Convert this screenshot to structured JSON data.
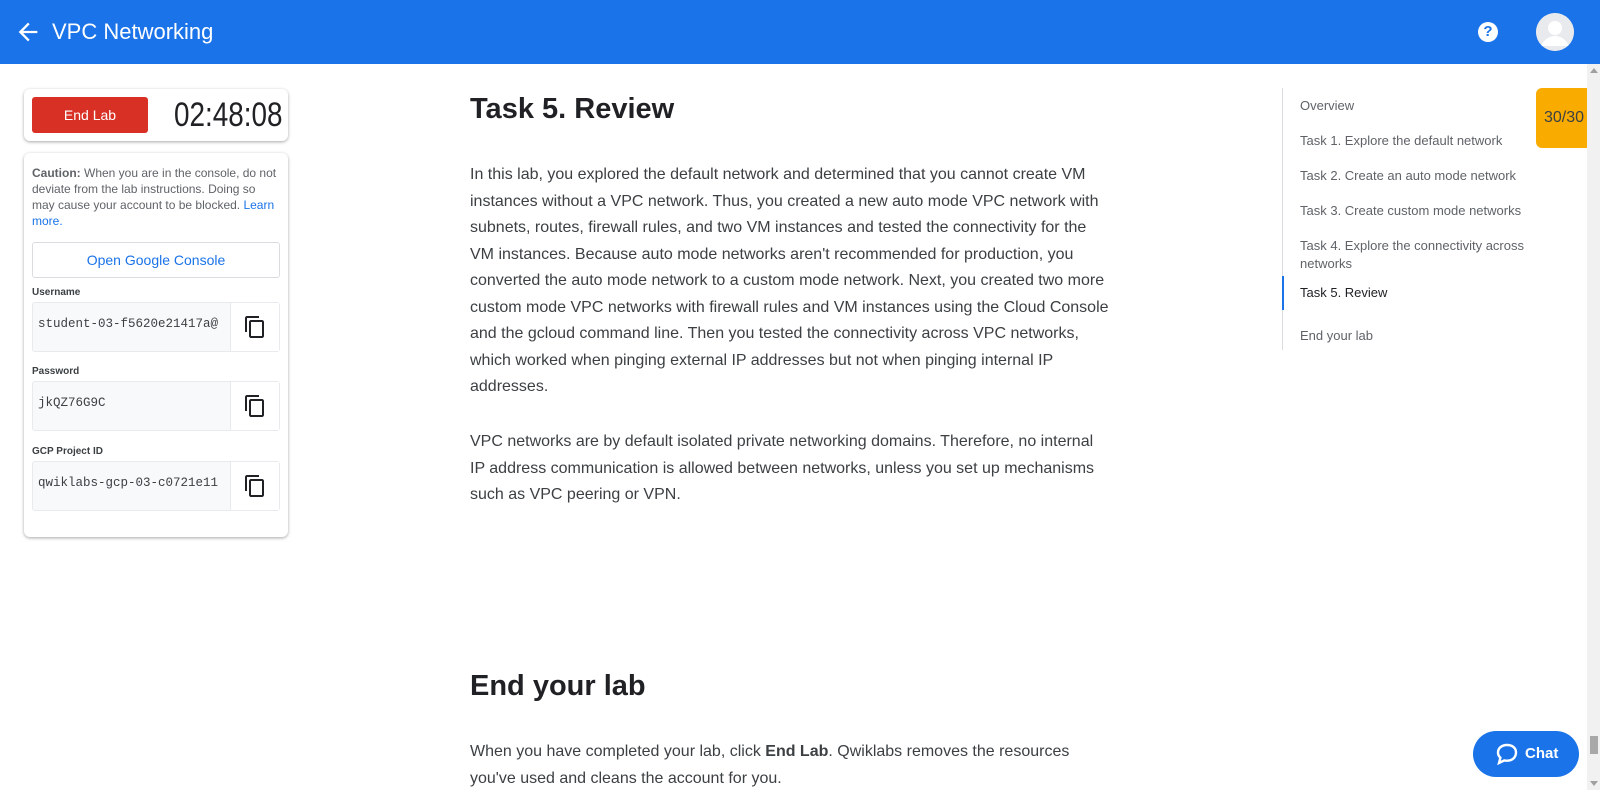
{
  "header": {
    "title": "VPC Networking",
    "help_icon": "?",
    "back_icon": "arrow-back-icon",
    "avatar_icon": "account-circle-icon"
  },
  "lab": {
    "end_label": "End Lab",
    "timer": "02:48:08",
    "caution_bold": "Caution:",
    "caution_text": " When you are in the console, do not deviate from the lab instructions. Doing so may cause your account to be blocked. ",
    "learn_more": "Learn more.",
    "console_label": "Open Google Console",
    "fields": [
      {
        "label": "Username",
        "value": "student-03-f5620e21417a@"
      },
      {
        "label": "Password",
        "value": "jkQZ76G9C"
      },
      {
        "label": "GCP Project ID",
        "value": "qwiklabs-gcp-03-c0721e11"
      }
    ]
  },
  "content": {
    "heading1": "Task 5. Review",
    "para1": "In this lab, you explored the default network and determined that you cannot create VM instances without a VPC network. Thus, you created a new auto mode VPC network with subnets, routes, firewall rules, and two VM instances and tested the connectivity for the VM instances. Because auto mode networks aren't recommended for production, you converted the auto mode network to a custom mode network. Next, you created two more custom mode VPC networks with firewall rules and VM instances using the Cloud Console and the gcloud command line. Then you tested the connectivity across VPC networks, which worked when pinging external IP addresses but not when pinging internal IP addresses.",
    "para2": "VPC networks are by default isolated private networking domains. Therefore, no internal IP address communication is allowed between networks, unless you set up mechanisms such as VPC peering or VPN.",
    "heading2": "End your lab",
    "para3_pre": "When you have completed your lab, click ",
    "para3_bold": "End Lab",
    "para3_post": ". Qwiklabs removes the resources you've used and cleans the account for you."
  },
  "toc": {
    "items": [
      "Overview",
      "Task 1. Explore the default network",
      "Task 2. Create an auto mode network",
      "Task 3. Create custom mode networks",
      "Task 4. Explore the connectivity across networks",
      "Task 5. Review",
      "End your lab"
    ],
    "active": "Task 5. Review"
  },
  "score": "30/30",
  "chat": {
    "label": "Chat"
  },
  "colors": {
    "brand": "#1a73e8",
    "end_lab": "#d93025",
    "score": "#f9ab00"
  }
}
